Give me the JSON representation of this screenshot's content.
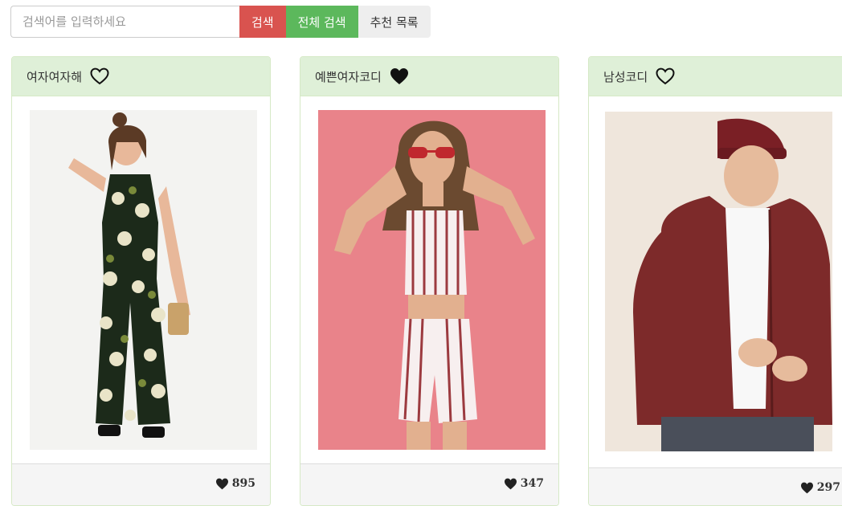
{
  "search": {
    "placeholder": "검색어를 입력하세요",
    "search_label": "검색",
    "all_label": "전체 검색",
    "recommend_label": "추천 목록"
  },
  "colors": {
    "search": "#d9534f",
    "all": "#5cb85c",
    "header": "#dff0d8"
  },
  "cards": [
    {
      "title": "여자여자해",
      "favorited": false,
      "likes": "895",
      "heart_icon": "heart-outline-icon"
    },
    {
      "title": "예쁜여자코디",
      "favorited": true,
      "likes": "347",
      "heart_icon": "heart-filled-icon"
    },
    {
      "title": "남성코디",
      "favorited": false,
      "likes": "297",
      "heart_icon": "heart-outline-icon"
    }
  ]
}
